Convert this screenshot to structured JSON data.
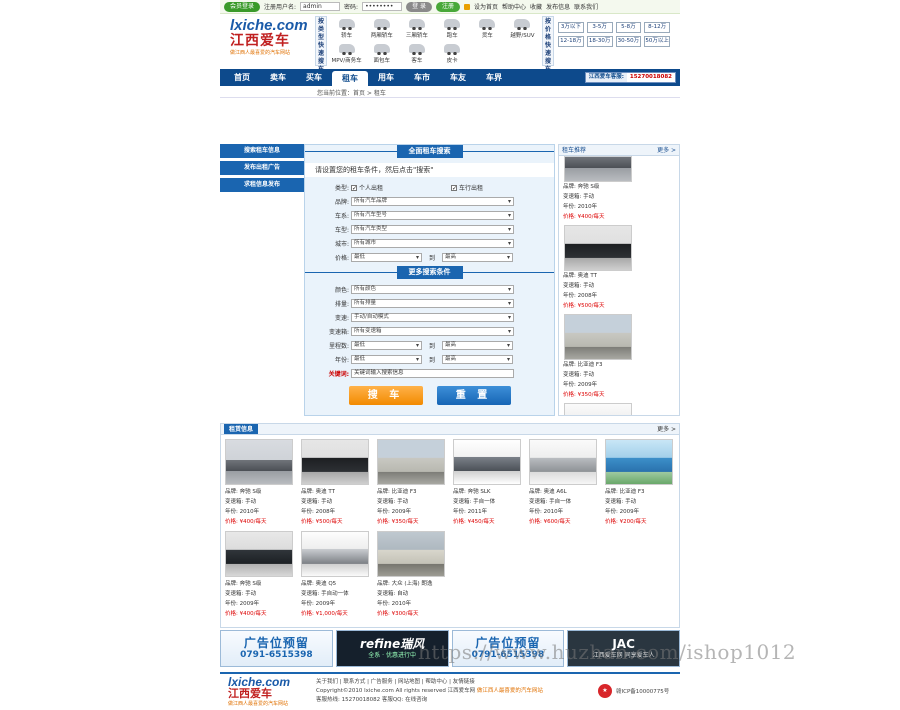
{
  "topbar": {
    "member_login": "会员登录",
    "username_label": "注册用户名:",
    "username_value": "admin",
    "password_label": "密码:",
    "password_value": "••••••••",
    "login_button": "登 录",
    "register_button": "注册",
    "links": [
      "设为首页",
      "帮助中心",
      "收藏",
      "发布信息",
      "联系我们"
    ]
  },
  "logo": {
    "domain": "lxiche.com",
    "name": "江西爱车",
    "slogan": "做江西人最喜爱的汽车网站"
  },
  "quick_type": {
    "title": "按类型快速搜车"
  },
  "car_types": [
    "轿车",
    "两厢轿车",
    "三厢轿车",
    "跑车",
    "货车",
    "越野/SUV",
    "MPV/商务车",
    "面包车",
    "客车",
    "皮卡"
  ],
  "quick_price": {
    "title": "按价格快速搜车"
  },
  "price_ranges": [
    "3万以下",
    "3-5万",
    "5-8万",
    "8-12万",
    "12-18万",
    "18-30万",
    "30-50万",
    "50万以上"
  ],
  "nav": {
    "items": [
      "首页",
      "卖车",
      "买车",
      "租车",
      "用车",
      "车市",
      "车友",
      "车界"
    ],
    "active_index": 3,
    "hotline_label": "江西爱车客服:",
    "hotline_number": "15270018082"
  },
  "breadcrumb": "您当前位置：首页 > 租车",
  "sidebar": {
    "items": [
      "搜索租车信息",
      "发布出租广告",
      "求租信息发布"
    ]
  },
  "search_form": {
    "title": "全面租车搜索",
    "intro": "请设置您的租车条件，然后点击\"搜索\"",
    "type_label": "类型:",
    "type_options": [
      "个人出租",
      "车行出租"
    ],
    "brand_label": "品牌:",
    "brand_value": "所有汽车品牌",
    "series_label": "车系:",
    "series_value": "所有汽车型号",
    "body_label": "车型:",
    "body_value": "所有汽车类型",
    "city_label": "城市:",
    "city_value": "所有城市",
    "price_label": "价格:",
    "price_from": "最低",
    "price_to": "最高",
    "more_title": "更多搜索条件",
    "color_label": "颜色:",
    "color_value": "所有颜色",
    "displacement_label": "排量:",
    "displacement_value": "所有排量",
    "gearbox_label": "变速:",
    "gearbox_value": "手动/自动模式",
    "fuel_label": "变速箱:",
    "fuel_value": "所有变速箱",
    "mileage_label": "里程数:",
    "mileage_from": "最低",
    "mileage_to": "最高",
    "year_label": "年份:",
    "year_from": "最低",
    "year_to": "最高",
    "keyword_label": "关键词:",
    "keyword_value": "关键词输入搜索信息",
    "range_sep": "到",
    "search_button": "搜 车",
    "reset_button": "重 置"
  },
  "recommend": {
    "title": "租车推荐",
    "more": "更多 >",
    "items": [
      {
        "brand": "品牌: 奔驰 S级",
        "gearbox": "变速箱: 手动",
        "year": "年份: 2010年",
        "price": "价格: ¥400/每天"
      },
      {
        "brand": "品牌: 奥迪 TT",
        "gearbox": "变速箱: 手动",
        "year": "年份: 2008年",
        "price": "价格: ¥500/每天"
      },
      {
        "brand": "品牌: 比亚迪 F3",
        "gearbox": "变速箱: 手动",
        "year": "年份: 2009年",
        "price": "价格: ¥350/每天"
      }
    ]
  },
  "listing": {
    "title": "租赁信息",
    "more": "更多 >",
    "cards": [
      {
        "brand": "品牌: 奔驰 S级",
        "gearbox": "变速箱: 手动",
        "year": "年份: 2010年",
        "price": "价格: ¥400/每天"
      },
      {
        "brand": "品牌: 奥迪 TT",
        "gearbox": "变速箱: 手动",
        "year": "年份: 2008年",
        "price": "价格: ¥500/每天"
      },
      {
        "brand": "品牌: 比亚迪 F3",
        "gearbox": "变速箱: 手动",
        "year": "年份: 2009年",
        "price": "价格: ¥350/每天"
      },
      {
        "brand": "品牌: 奔驰 SLK",
        "gearbox": "变速箱: 手自一体",
        "year": "年份: 2011年",
        "price": "价格: ¥450/每天"
      },
      {
        "brand": "品牌: 奥迪 A6L",
        "gearbox": "变速箱: 手自一体",
        "year": "年份: 2010年",
        "price": "价格: ¥600/每天"
      },
      {
        "brand": "品牌: 比亚迪 F3",
        "gearbox": "变速箱: 手动",
        "year": "年份: 2009年",
        "price": "价格: ¥200/每天"
      },
      {
        "brand": "品牌: 奔驰 S级",
        "gearbox": "变速箱: 手动",
        "year": "年份: 2009年",
        "price": "价格: ¥400/每天"
      },
      {
        "brand": "品牌: 奥迪 Q5",
        "gearbox": "变速箱: 手自动一体",
        "year": "年份: 2009年",
        "price": "价格: ¥1,000/每天"
      },
      {
        "brand": "品牌: 大众 (上海) 朗逸",
        "gearbox": "变速箱: 自动",
        "year": "年份: 2010年",
        "price": "价格: ¥300/每天"
      }
    ]
  },
  "banners": [
    {
      "line1": "广告位预留",
      "line2": "0791-6515398"
    },
    {
      "line1": "refine瑞风",
      "line2": "全系 · 优惠进行中"
    },
    {
      "line1": "广告位预留",
      "line2": "0791-6515398"
    },
    {
      "line1": "JAC",
      "line2": "江西爱车网 同享爱车人"
    }
  ],
  "footer": {
    "links": "关于我们 | 联系方式 | 广告服务 | 网站地图 | 帮助中心 | 友情链接",
    "copyright": "Copyright©2010 lxiche.com All rights reserved 江西爱车网",
    "slogan": "做江西人最喜爱的汽车网站",
    "contact": "客服热线: 15270018082 客服QQ: 在线咨询",
    "icp": "赣ICP备10000775号"
  },
  "watermark": "https://www.huzhan.com/ishop1012"
}
